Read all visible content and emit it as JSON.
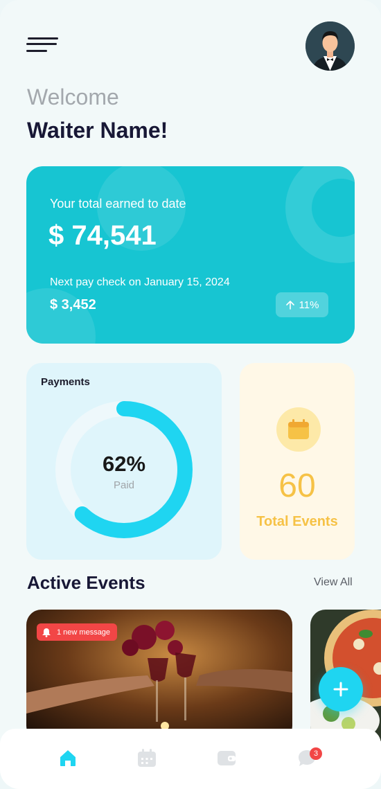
{
  "header": {
    "welcome": "Welcome",
    "name": "Waiter Name!"
  },
  "earnings": {
    "label": "Your total earned to date",
    "total": "$ 74,541",
    "next_pay_label": "Next pay check on January 15, 2024",
    "next_pay_amount": "$ 3,452",
    "growth": "11%"
  },
  "payments": {
    "title": "Payments",
    "percent_text": "62%",
    "percent_value": 62,
    "sub": "Paid"
  },
  "events_stat": {
    "count": "60",
    "label": "Total Events"
  },
  "active_events": {
    "title": "Active Events",
    "view_all": "View All",
    "badge": "1 new message"
  },
  "nav": {
    "badge_count": "3"
  },
  "colors": {
    "accent": "#17c5d2",
    "ring": "#1fd5f1",
    "gold": "#f6c246",
    "alert": "#f24646"
  },
  "icons": [
    "menu-icon",
    "avatar",
    "arrow-up-icon",
    "calendar-icon",
    "bell-icon",
    "plus-icon",
    "home-icon",
    "calendar-icon",
    "wallet-icon",
    "chat-icon"
  ]
}
